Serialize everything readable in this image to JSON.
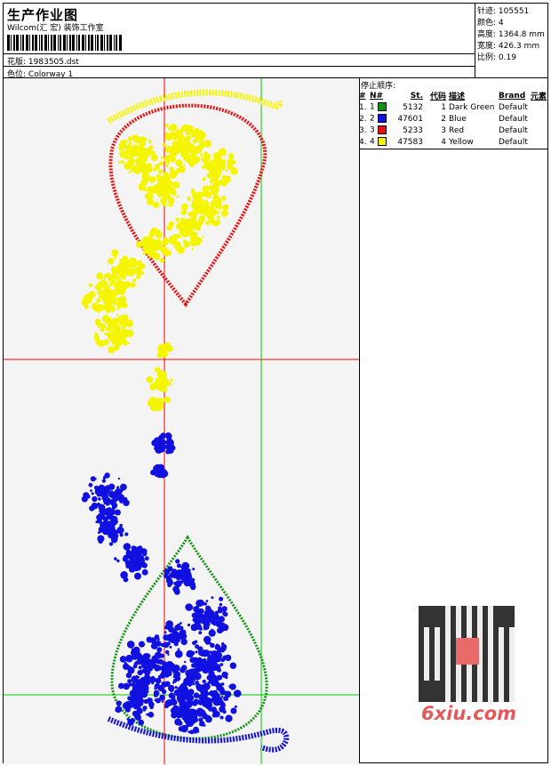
{
  "header": {
    "title": "生产作业图",
    "studio": "Wilcom(汇 宏) 装饰工作室",
    "design_label": "花版:",
    "design_value": "1983505.dst",
    "colorway_label": "色位:",
    "colorway_value": "Colorway 1"
  },
  "stats": [
    {
      "label": "针迹:",
      "value": "105551"
    },
    {
      "label": "颜色:",
      "value": "4"
    },
    {
      "label": "高度:",
      "value": "1364.8 mm"
    },
    {
      "label": "宽度:",
      "value": "426.3 mm"
    },
    {
      "label": "比例:",
      "value": "0.19"
    }
  ],
  "stop_sequence": {
    "title": "停止顺序:",
    "headers": [
      "#",
      "N#",
      "St.",
      "代码",
      "描述",
      "Brand",
      "元素"
    ],
    "rows": [
      {
        "idx": "1.",
        "n": "1",
        "color": "#109410",
        "st": "5132",
        "code": "1",
        "desc": "Dark Green",
        "brand": "Default"
      },
      {
        "idx": "2.",
        "n": "2",
        "color": "#1010e0",
        "st": "47601",
        "code": "2",
        "desc": "Blue",
        "brand": "Default"
      },
      {
        "idx": "3.",
        "n": "3",
        "color": "#e81010",
        "st": "5233",
        "code": "3",
        "desc": "Red",
        "brand": "Default"
      },
      {
        "idx": "4.",
        "n": "4",
        "color": "#f5f500",
        "st": "47583",
        "code": "4",
        "desc": "Yellow",
        "brand": "Default"
      }
    ]
  },
  "watermark": {
    "text": "6xiu.com",
    "qr_icon": "qr-code-icon"
  },
  "colors": {
    "green": "#109410",
    "blue": "#1010e0",
    "red": "#e81010",
    "yellow": "#f5f500",
    "guide_red": "#ff0000",
    "guide_green": "#00cc00"
  }
}
